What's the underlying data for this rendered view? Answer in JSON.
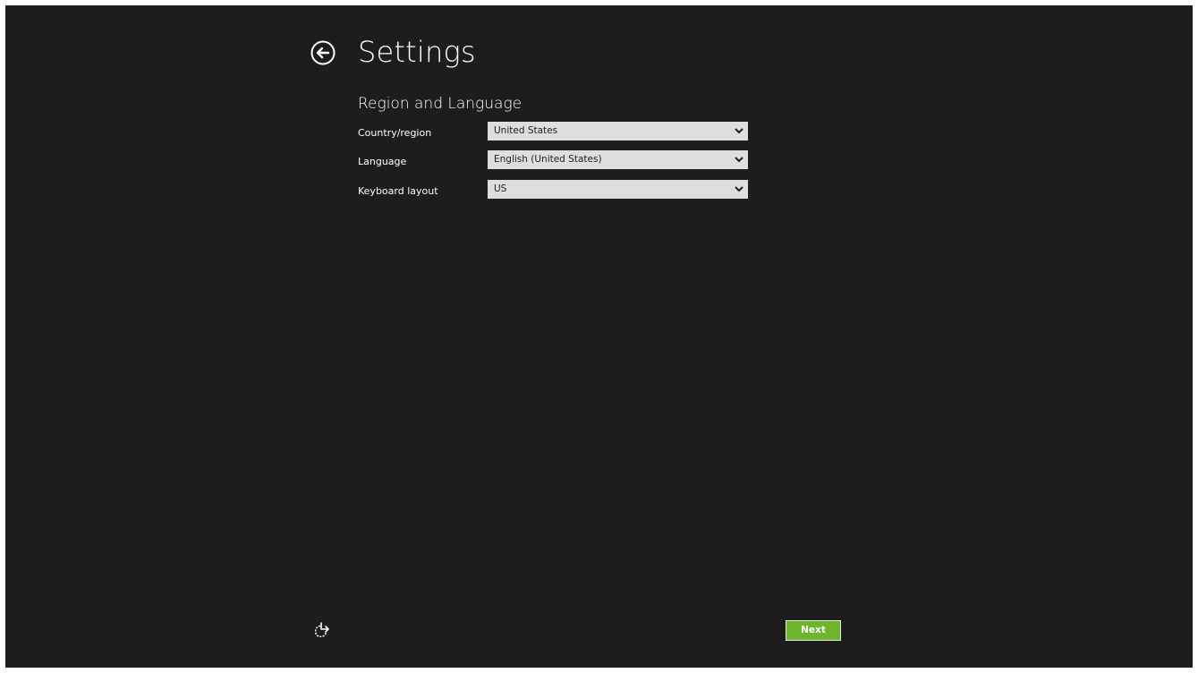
{
  "header": {
    "title": "Settings",
    "back_icon": "arrow-left-circle-icon"
  },
  "section": {
    "title": "Region and Language"
  },
  "fields": [
    {
      "label": "Country/region",
      "value": "United States"
    },
    {
      "label": "Language",
      "value": "English (United States)"
    },
    {
      "label": "Keyboard layout",
      "value": "US"
    }
  ],
  "footer": {
    "ease_of_access_icon": "ease-of-access-icon",
    "next_label": "Next"
  },
  "colors": {
    "background": "#1d1d1d",
    "text": "#ffffff",
    "select_background": "#dedede",
    "accent": "#6cb52d"
  }
}
